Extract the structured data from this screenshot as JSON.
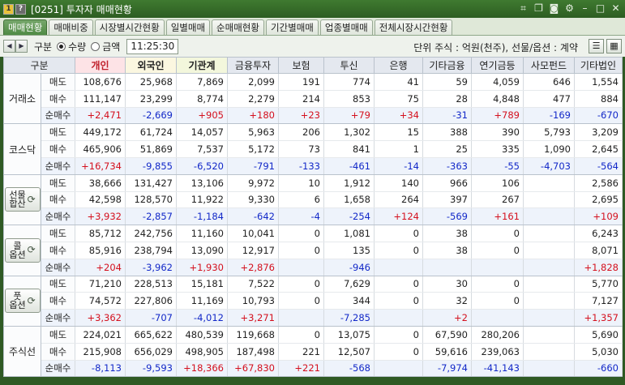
{
  "window": {
    "num1": "1",
    "num2": "?",
    "title": "[0251] 투자자 매매현황"
  },
  "icons": [
    "link-icon",
    "copy-icon",
    "camera-icon",
    "gear-icon",
    "minimize-icon",
    "maximize-icon",
    "close-icon"
  ],
  "tabs": [
    "매매현황",
    "매매비중",
    "시장별시간현황",
    "일별매매",
    "순매매현황",
    "기간별매매",
    "업종별매매",
    "전체시장시간현황"
  ],
  "active_tab": 0,
  "controls": {
    "group_label": "구분",
    "radio_qty": "수량",
    "radio_amt": "금액",
    "time": "11:25:30",
    "unit_text": "단위 주식 : 억원(천주), 선물/옵션 : 계약"
  },
  "table": {
    "headers": [
      "구분",
      "개인",
      "외국인",
      "기관계",
      "금융투자",
      "보험",
      "투신",
      "은행",
      "기타금융",
      "연기금등",
      "사모펀드",
      "기타법인"
    ],
    "row_labels": [
      "매도",
      "매수",
      "순매수"
    ],
    "groups": [
      {
        "name": "거래소",
        "rows": [
          [
            "108,676",
            "25,968",
            "7,869",
            "2,099",
            "191",
            "774",
            "41",
            "59",
            "4,059",
            "646",
            "1,554"
          ],
          [
            "111,147",
            "23,299",
            "8,774",
            "2,279",
            "214",
            "853",
            "75",
            "28",
            "4,848",
            "477",
            "884"
          ],
          [
            "+2,471",
            "-2,669",
            "+905",
            "+180",
            "+23",
            "+79",
            "+34",
            "-31",
            "+789",
            "-169",
            "-670"
          ]
        ]
      },
      {
        "name": "코스닥",
        "rows": [
          [
            "449,172",
            "61,724",
            "14,057",
            "5,963",
            "206",
            "1,302",
            "15",
            "388",
            "390",
            "5,793",
            "3,209"
          ],
          [
            "465,906",
            "51,869",
            "7,537",
            "5,172",
            "73",
            "841",
            "1",
            "25",
            "335",
            "1,090",
            "2,645"
          ],
          [
            "+16,734",
            "-9,855",
            "-6,520",
            "-791",
            "-133",
            "-461",
            "-14",
            "-363",
            "-55",
            "-4,703",
            "-564"
          ]
        ]
      },
      {
        "name": "선물\n합산",
        "button": true,
        "rows": [
          [
            "38,666",
            "131,427",
            "13,106",
            "9,972",
            "10",
            "1,912",
            "140",
            "966",
            "106",
            "",
            "2,586"
          ],
          [
            "42,598",
            "128,570",
            "11,922",
            "9,330",
            "6",
            "1,658",
            "264",
            "397",
            "267",
            "",
            "2,695"
          ],
          [
            "+3,932",
            "-2,857",
            "-1,184",
            "-642",
            "-4",
            "-254",
            "+124",
            "-569",
            "+161",
            "",
            "+109"
          ]
        ]
      },
      {
        "name": "콜\n옵션",
        "button": true,
        "rows": [
          [
            "85,712",
            "242,756",
            "11,160",
            "10,041",
            "0",
            "1,081",
            "0",
            "38",
            "0",
            "",
            "6,243"
          ],
          [
            "85,916",
            "238,794",
            "13,090",
            "12,917",
            "0",
            "135",
            "0",
            "38",
            "0",
            "",
            "8,071"
          ],
          [
            "+204",
            "-3,962",
            "+1,930",
            "+2,876",
            "",
            "-946",
            "",
            "",
            "",
            "",
            "+1,828"
          ]
        ]
      },
      {
        "name": "풋\n옵션",
        "button": true,
        "rows": [
          [
            "71,210",
            "228,513",
            "15,181",
            "7,522",
            "0",
            "7,629",
            "0",
            "30",
            "0",
            "",
            "5,770"
          ],
          [
            "74,572",
            "227,806",
            "11,169",
            "10,793",
            "0",
            "344",
            "0",
            "32",
            "0",
            "",
            "7,127"
          ],
          [
            "+3,362",
            "-707",
            "-4,012",
            "+3,271",
            "",
            "-7,285",
            "",
            "+2",
            "",
            "",
            "+1,357"
          ]
        ]
      },
      {
        "name": "주식선",
        "rows": [
          [
            "224,021",
            "665,622",
            "480,539",
            "119,668",
            "0",
            "13,075",
            "0",
            "67,590",
            "280,206",
            "",
            "5,690"
          ],
          [
            "215,908",
            "656,029",
            "498,905",
            "187,498",
            "221",
            "12,507",
            "0",
            "59,616",
            "239,063",
            "",
            "5,030"
          ],
          [
            "-8,113",
            "-9,593",
            "+18,366",
            "+67,830",
            "+221",
            "-568",
            "",
            "-7,974",
            "-41,143",
            "",
            "-660"
          ]
        ]
      }
    ]
  },
  "colors": {
    "positive": "#d4101e",
    "negative": "#1228c8",
    "frame": "#2f5a24"
  }
}
